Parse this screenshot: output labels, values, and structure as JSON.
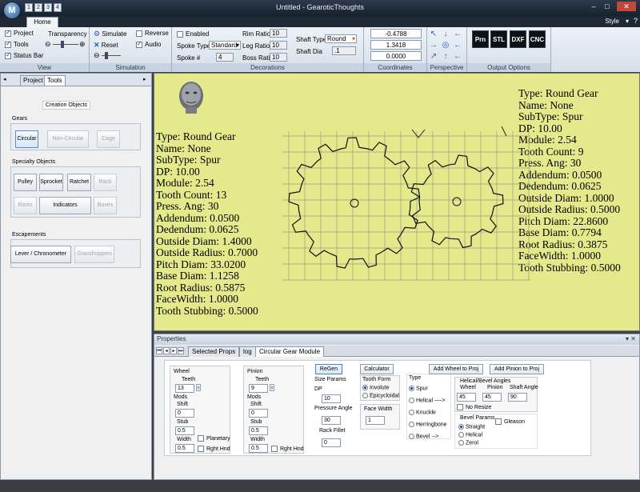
{
  "app": {
    "title": "Untitled - GearoticThoughts",
    "logo_letter": "M",
    "style_label": "Style"
  },
  "qat": [
    "1",
    "2",
    "3",
    "4"
  ],
  "window_controls": [
    "–",
    "□",
    "✕"
  ],
  "ribbon_tabs": {
    "home": "Home"
  },
  "view_group": {
    "label": "View",
    "project": "Project",
    "tools": "Tools",
    "status_bar": "Status Bar",
    "transparency": "Transparency"
  },
  "sim_group": {
    "label": "Simulation",
    "simulate": "Simulate",
    "reset": "Reset",
    "reverse": "Reverse",
    "audio": "Audio"
  },
  "decor_group": {
    "label": "Decorations",
    "enabled": "Enabled",
    "spoke_type": "Spoke Type",
    "spoke_type_val": "Standard",
    "spoke_num": "Spoke #",
    "spoke_num_val": "4",
    "rim_ratio": "Rim Ratio",
    "rim_ratio_val": "10",
    "leg_ratio": "Leg Ratio",
    "leg_ratio_val": "10",
    "boss_ratio": "Boss Ratio",
    "boss_ratio_val": "10",
    "shaft_type": "Shaft Type",
    "shaft_type_val": "Round",
    "shaft_dia": "Shaft Dia",
    "shaft_dia_val": ".1"
  },
  "coords_group": {
    "label": "Coordinates",
    "values": [
      "-0.4788",
      "1.3418",
      "0.0000"
    ]
  },
  "persp_group": {
    "label": "Perspective"
  },
  "output_group": {
    "label": "Output Options",
    "buttons": [
      "Prn",
      "STL",
      "DXF",
      "CNC"
    ]
  },
  "left_panel": {
    "tabs": [
      "Project",
      "Tools"
    ],
    "creation_objects": "Creation Objects",
    "gears": "Gears",
    "circular": "Circular",
    "non_circular": "Non-Circular",
    "cage": "Cage",
    "specialty": "Specialty Objects",
    "pulley": "Pulley",
    "sprocket": "Sprocket",
    "ratchet": "Ratchet",
    "rack": "Rack",
    "roots": "Roots",
    "indicators": "Indicators",
    "boxes": "Boxes",
    "escapements": "Escapements",
    "lever": "Lever / Chronometer",
    "grasshoppers": "Grasshoppers"
  },
  "canvas": {
    "wheel_info": [
      "Type: Round Gear",
      "Name: None",
      "SubType: Spur",
      "DP: 10.00",
      "Module: 2.54",
      "Tooth Count: 13",
      "Press. Ang: 30",
      "Addendum: 0.0500",
      "Dedendum: 0.0625",
      "Outside Diam: 1.4000",
      "Outside Radius: 0.7000",
      "Pitch Diam: 33.0200",
      "Base Diam: 1.1258",
      "Root Radius: 0.5875",
      "FaceWidth: 1.0000",
      "Tooth Stubbing: 0.5000"
    ],
    "pinion_info": [
      "Type: Round Gear",
      "Name: None",
      "SubType: Spur",
      "DP: 10.00",
      "Module: 2.54",
      "Tooth Count: 9",
      "Press. Ang: 30",
      "Addendum: 0.0500",
      "Dedendum: 0.0625",
      "Outside Diam: 1.0000",
      "Outside Radius: 0.5000",
      "Pitch Diam: 22.8600",
      "Base Diam: 0.7794",
      "Root Radius: 0.3875",
      "FaceWidth: 1.0000",
      "Tooth Stubbing: 0.5000"
    ]
  },
  "properties": {
    "header": "Properties",
    "pin": "▾ ✕",
    "tabs": [
      "Selected Props",
      "log",
      "Circular Gear Module"
    ],
    "wheel": {
      "title": "Wheel",
      "teeth": "Teeth",
      "teeth_val": "13",
      "mods": "Mods",
      "shift": "Shift",
      "shift_val": "0",
      "stub": "Stub",
      "stub_val": "0.5",
      "width": "Width",
      "width_val": "0.5",
      "planetary": "Planetary",
      "rght_hnd": "Rght Hnd"
    },
    "pinion": {
      "title": "Pinion",
      "teeth": "Teeth",
      "teeth_val": "9",
      "mods": "Mods",
      "shift": "Shift",
      "shift_val": "0",
      "stub": "Stub",
      "stub_val": "0.5",
      "width": "Width",
      "width_val": "0.5",
      "rght_hnd": "Rght Hnd"
    },
    "regen": "ReGen",
    "calculator": "Calculator",
    "size_params": "Size Params",
    "dp": "DP",
    "dp_val": "10",
    "pressure_angle": "Pressure Angle",
    "pressure_angle_val": "30",
    "rack_fillet": "Rack Fillet",
    "rack_fillet_val": "0",
    "tooth_form": "Tooth Form",
    "involute": "Involute",
    "epicycloidal": "Epicycloidal",
    "face_width": "Face Width",
    "face_width_val": "1",
    "type": "Type",
    "spur": "Spur",
    "helical": "Helical  ---->",
    "knuckle": "Knuckle",
    "herringbone": "Herringbone",
    "bevel": "Bevel      -->",
    "add_wheel": "Add Wheel to Proj",
    "add_pinion": "Add Pinion to Proj",
    "helical_bevel_angles": "Helical/Bevel Angles",
    "hb_wheel": "Wheel",
    "hb_pinion": "Pinion",
    "hb_shaft": "Shaft Angle",
    "hb_wheel_val": "45",
    "hb_pinion_val": "45",
    "hb_shaft_val": "90",
    "no_resize": "No Resize",
    "bevel_params": "Bevel Params",
    "straight": "Straight",
    "bp_helical": "Helical",
    "zerol": "Zerol",
    "gleason": "Gleason"
  }
}
